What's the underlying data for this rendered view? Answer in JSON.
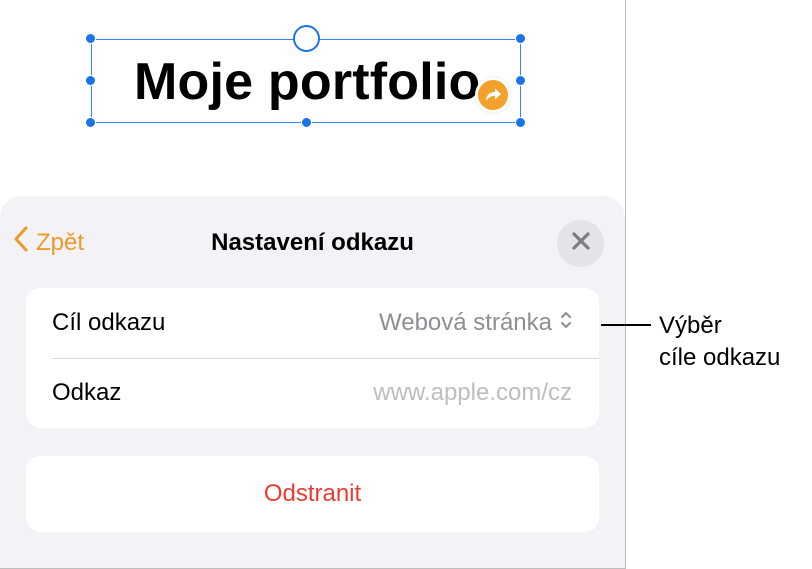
{
  "canvas": {
    "text_box_text": "Moje portfolio"
  },
  "sheet": {
    "back_label": "Zpět",
    "title": "Nastavení odkazu",
    "close_icon": "close-icon",
    "rows": [
      {
        "label": "Cíl odkazu",
        "value": "Webová stránka",
        "icon": "chevron-up-down-icon"
      },
      {
        "label": "Odkaz",
        "placeholder": "www.apple.com/cz"
      }
    ],
    "delete_label": "Odstranit"
  },
  "callout": {
    "line1": "Výběr",
    "line2": "cíle odkazu"
  },
  "colors": {
    "accent": "#f09a26",
    "selection": "#1a73e8",
    "destructive": "#ec3b34",
    "sheet_background": "#f2f2f7"
  }
}
